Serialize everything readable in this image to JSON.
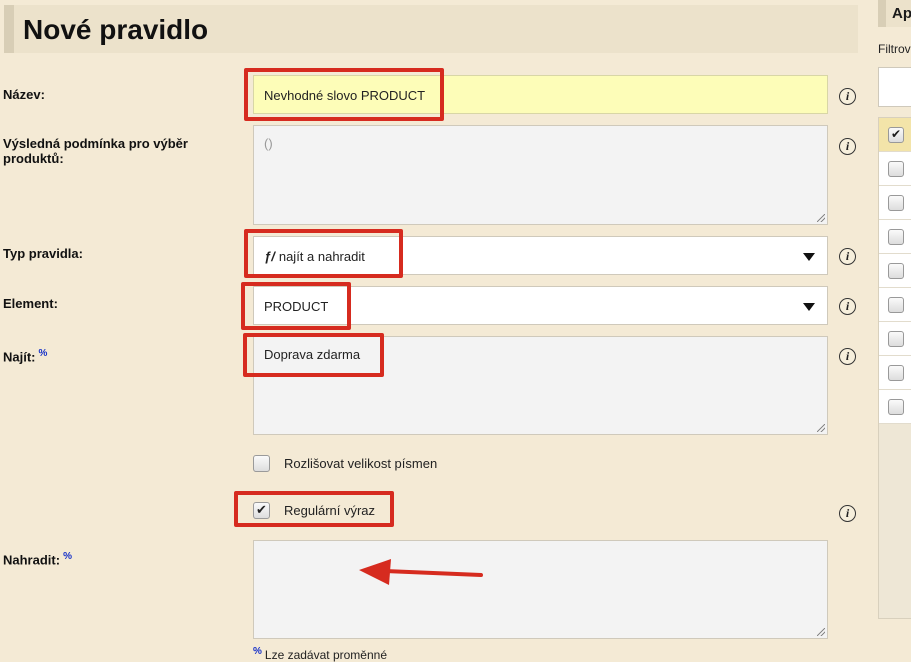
{
  "title": "Nové pravidlo",
  "form": {
    "name_label": "Název:",
    "name_value": "Nevhodné slovo PRODUCT",
    "condition_label": "Výsledná podmínka pro výběr produktů:",
    "condition_placeholder": "()",
    "rule_type_label": "Typ pravidla:",
    "rule_type_value": "najít a nahradit",
    "element_label": "Element:",
    "element_value": "PRODUCT",
    "find_label": "Najít:",
    "find_marker": "%",
    "find_value": "Doprava zdarma",
    "case_label": "Rozlišovat velikost písmen",
    "case_checked": false,
    "regex_label": "Regulární výraz",
    "regex_checked": true,
    "replace_label": "Nahradit:",
    "replace_marker": "%",
    "replace_value": "",
    "variables_note_marker": "%",
    "variables_note": "Lze zadávat proměnné"
  },
  "sidebar": {
    "title": "Ap",
    "filter_label": "Filtrov",
    "rows": [
      {
        "checked": true
      },
      {
        "checked": false
      },
      {
        "checked": false
      },
      {
        "checked": false
      },
      {
        "checked": false
      },
      {
        "checked": false
      },
      {
        "checked": false
      },
      {
        "checked": false
      },
      {
        "checked": false
      }
    ]
  },
  "icons": {
    "info": "info-icon",
    "rule_type": "find-replace-icon",
    "dropdown": "chevron-down-icon",
    "check": "✔"
  },
  "colors": {
    "background": "#f4ead5",
    "highlight": "#d62b1f",
    "input_yellow": "#fdfdb8",
    "variable_marker": "#1530c8"
  }
}
